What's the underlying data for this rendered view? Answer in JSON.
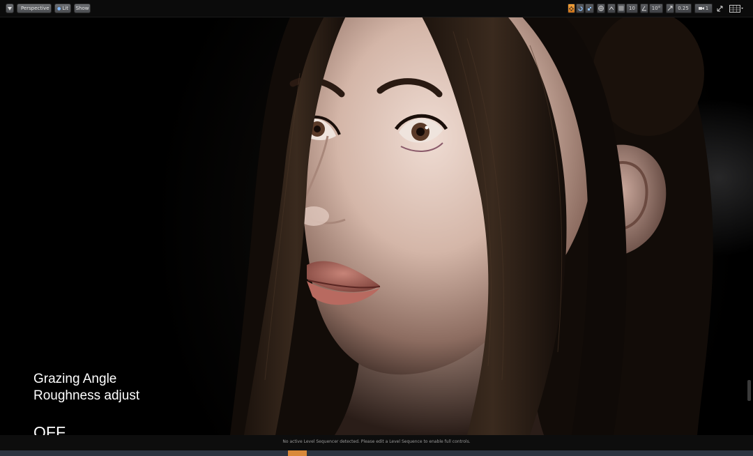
{
  "toolbar": {
    "left": {
      "menu_icon": "dropdown-triangle-icon",
      "perspective_label": "Perspective",
      "lit_label": "Lit",
      "show_label": "Show"
    },
    "right": {
      "grid_snap_value": "10",
      "rotation_snap_value": "10°",
      "scale_snap_value": "0.25",
      "camera_speed_value": "1"
    }
  },
  "overlay": {
    "line1": "Grazing Angle",
    "line2": "Roughness adjust",
    "state": "OFF"
  },
  "status": {
    "message": "No active Level Sequencer detected. Please edit a Level Sequence to enable full controls."
  },
  "colors": {
    "accent": "#f2a23a",
    "toolbar_bg": "#0b0b0b",
    "button": "#5a5c60",
    "timeline": "#2c3440",
    "timeline_marker": "#d9893a"
  }
}
